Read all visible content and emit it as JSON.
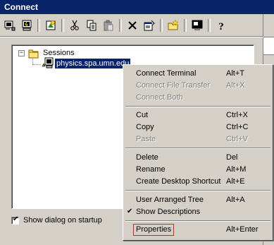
{
  "window": {
    "title": "Connect"
  },
  "toolbar": {
    "buttons": [
      {
        "name": "connect-icon"
      },
      {
        "name": "quick-connect-icon"
      },
      {
        "name": "new-session-icon"
      },
      {
        "name": "cut-icon"
      },
      {
        "name": "copy-icon"
      },
      {
        "name": "paste-icon"
      },
      {
        "name": "delete-icon"
      },
      {
        "name": "properties-icon"
      },
      {
        "name": "new-folder-icon"
      },
      {
        "name": "desktop-shortcut-icon"
      },
      {
        "name": "help-icon"
      }
    ]
  },
  "tree": {
    "root_label": "Sessions",
    "root_expander": "−",
    "session_label": "physics.spa.umn.edu"
  },
  "options": {
    "show_dialog_label": "Show dialog on startup",
    "show_dialog_checked": true
  },
  "context_menu": {
    "items": [
      {
        "label": "Connect Terminal",
        "accel": "Alt+T",
        "enabled": true
      },
      {
        "label": "Connect File Transfer",
        "accel": "Alt+X",
        "enabled": false
      },
      {
        "label": "Connect Both",
        "accel": "",
        "enabled": false
      },
      {
        "label": "Cut",
        "accel": "Ctrl+X",
        "enabled": true
      },
      {
        "label": "Copy",
        "accel": "Ctrl+C",
        "enabled": true
      },
      {
        "label": "Paste",
        "accel": "Ctrl+V",
        "enabled": false
      },
      {
        "label": "Delete",
        "accel": "Del",
        "enabled": true
      },
      {
        "label": "Rename",
        "accel": "Alt+M",
        "enabled": true
      },
      {
        "label": "Create Desktop Shortcut",
        "accel": "Alt+E",
        "enabled": true
      },
      {
        "label": "User Arranged Tree",
        "accel": "Alt+A",
        "enabled": true
      },
      {
        "label": "Show Descriptions",
        "accel": "",
        "enabled": true,
        "checked": true
      },
      {
        "label": "Properties",
        "accel": "Alt+Enter",
        "enabled": true,
        "highlighted": true
      }
    ]
  },
  "colors": {
    "title_bar": "#0a246a",
    "highlight_box": "#e02020",
    "selection": "#0a246a"
  }
}
